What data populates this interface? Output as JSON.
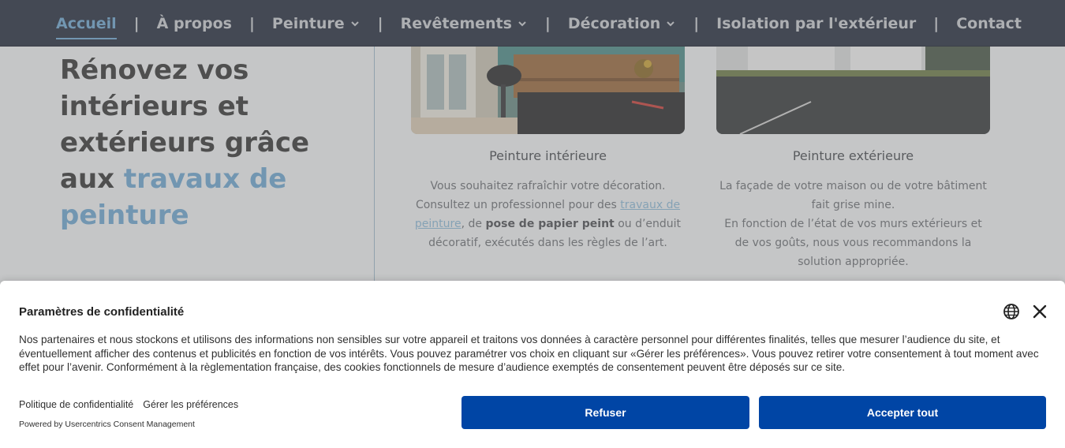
{
  "nav": {
    "items": [
      {
        "label": "Accueil",
        "active": true,
        "dropdown": false
      },
      {
        "label": "À propos",
        "active": false,
        "dropdown": false
      },
      {
        "label": "Peinture",
        "active": false,
        "dropdown": true
      },
      {
        "label": "Revêtements",
        "active": false,
        "dropdown": true
      },
      {
        "label": "Décoration",
        "active": false,
        "dropdown": true
      },
      {
        "label": "Isolation par l'extérieur",
        "active": false,
        "dropdown": false
      },
      {
        "label": "Contact",
        "active": false,
        "dropdown": false
      }
    ],
    "separator": "|"
  },
  "hero": {
    "line_plain": "Rénovez vos intérieurs et extérieurs grâce aux ",
    "line_accent": "travaux de peinture"
  },
  "cards": [
    {
      "title": "Peinture intérieure",
      "text_1": "Vous souhaitez rafraîchir votre décoration. Consultez un professionnel pour des ",
      "link": "travaux de peinture",
      "text_2": ", de ",
      "bold": "pose de papier peint",
      "text_3": " ou d’enduit décoratif, exécutés dans les règles de l’art."
    },
    {
      "title": "Peinture extérieure",
      "text_1": "La façade de votre maison ou de votre bâtiment fait grise mine.",
      "text_2": "En fonction de l’état de vos murs extérieurs et de vos goûts, nous vous recommandons la solution appropriée."
    }
  ],
  "consent": {
    "title": "Paramètres de confidentialité",
    "body": "Nos partenaires et nous stockons et utilisons des informations non sensibles sur votre appareil et traitons vos données à caractère personnel pour différentes finalités, telles que mesurer l’audience du site, et éventuellement afficher des contenus et publicités en fonction de vos intérêts. Vous pouvez paramétrer vos choix en cliquant sur «Gérer les préférences». Vous pouvez retirer votre consentement à tout moment avec effet pour l’avenir. Conformément à la règlementation française, des cookies fonctionnels de mesure d’audience exemptés de consentement peuvent être déposés sur ce site.",
    "privacy_link": "Politique de confidentialité",
    "manage_link": "Gérer les préférences",
    "powered_by": "Powered by Usercentrics Consent Management",
    "refuse_label": "Refuser",
    "accept_label": "Accepter tout",
    "icons": {
      "language": "globe-icon",
      "close": "close-icon"
    },
    "button_color": "#0045a5"
  },
  "colors": {
    "nav_bg": "#283041",
    "accent": "#6fa6cf"
  }
}
